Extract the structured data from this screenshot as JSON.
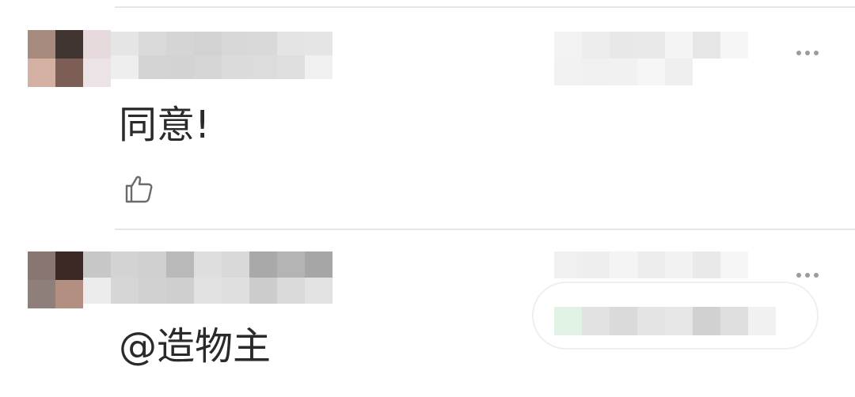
{
  "comments": [
    {
      "text": "同意!",
      "avatar_colors": [
        "#a68a7e",
        "#3f3430",
        "#e6dadd",
        "#d3b0a2",
        "#7c5e57",
        "#ece3e6"
      ],
      "name_colors": [
        "#e5e5e5",
        "#dadada",
        "#d5d5d5",
        "#d2d2d2",
        "#d8d8d8",
        "#d9d9d9",
        "#e4e4e4",
        "#e5e5e5",
        "#eeeeee",
        "#d4d4d4",
        "#d3d3d3",
        "#d6d6d6",
        "#dbdbdb",
        "#dcdcdc",
        "#dfdfdf",
        "#f0f0f0"
      ],
      "meta_colors": [
        "#f3f3f3",
        "#ededed",
        "#e8e8e8",
        "#e9e9e9",
        "#f4f4f4",
        "#e6e6e6",
        "#f5f5f5",
        "#f2f2f2",
        "#f0f0f0",
        "#f1f1f1",
        "#f6f6f6",
        "#efefef"
      ],
      "icons": {
        "more": "more-dots-icon",
        "like": "thumbs-up-icon"
      }
    },
    {
      "text": "@造物主",
      "avatar_colors": [
        "#8a7670",
        "#3b2925",
        "#8f7f7b",
        "#b28f80"
      ],
      "name_colors": [
        "#c7c7c7",
        "#d3d3d3",
        "#d0d0d0",
        "#b9b9b9",
        "#dedede",
        "#d9d9d9",
        "#a9a9a9",
        "#b4b4b4",
        "#a6a6a6",
        "#ececec",
        "#d6d6d6",
        "#d1d1d1",
        "#cfcfcf",
        "#e1e1e1",
        "#dfdfdf",
        "#cccccc",
        "#dadada",
        "#e3e3e3"
      ],
      "meta_colors": [
        "#f0f0f0",
        "#eeeeee",
        "#f4f4f4",
        "#ededed",
        "#f2f2f2",
        "#e9e9e9",
        "#f5f5f5",
        "#f1f1f1"
      ],
      "reply_colors": [
        "#e0f2e3",
        "#e2e2e2",
        "#dadada",
        "#e4e4e4",
        "#e6e6e6",
        "#d1d1d1",
        "#dfdfdf",
        "#f1f1f1"
      ],
      "icons": {
        "more": "more-dots-icon"
      }
    }
  ]
}
